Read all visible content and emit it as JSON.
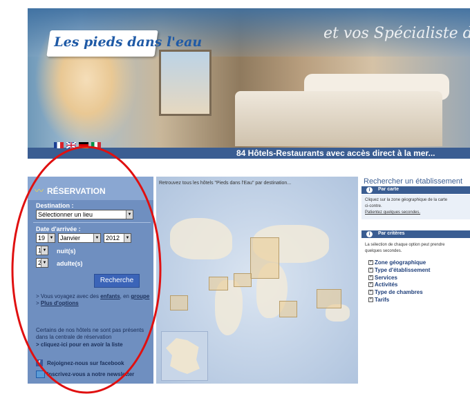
{
  "banner": {
    "logo": "Les pieds dans l'eau",
    "tagline": "et vos Spécialiste des Hôtels.",
    "bar_text": "84 Hôtels-Restaurants avec accès direct à la mer...",
    "flags": [
      "fr-flag-icon",
      "uk-flag-icon",
      "de-flag-icon",
      "it-flag-icon"
    ]
  },
  "reservation": {
    "title": "RÉSERVATION",
    "destination_label": "Destination :",
    "destination_value": "Sélectionner un lieu",
    "date_label": "Date d'arrivée :",
    "day": "19",
    "month": "Janvier",
    "year": "2012",
    "nights_value": "1",
    "nights_label": "nuit(s)",
    "adults_value": "2",
    "adults_label": "adulte(s)",
    "search_button": "Recherche",
    "travel_prefix": "> Vous voyagez avec des",
    "travel_children": "enfants",
    "travel_sep": ", en",
    "travel_group": "groupe",
    "more_options": "Plus d'options",
    "more_options_prefix": "> ",
    "notice_line1": "Certains de nos hôtels ne sont pas présents",
    "notice_line2": "dans la centrale de réservation",
    "notice_link": "> cliquez-ici pour en avoir la liste",
    "facebook": "Rejoignez-nous sur facebook",
    "newsletter": "Inscrivez-vous a notre newsletter"
  },
  "map": {
    "intro": "Retrouvez tous les hôtels \"Pieds dans l'Eau\" par destination..."
  },
  "search_panel": {
    "title": "Rechercher un établissement",
    "by_map": {
      "label": "Par carte",
      "line1": "Cliquez sur la zone géographique de la carte",
      "line2": "ci-contre.",
      "line3": "Patientez quelques secondes."
    },
    "by_criteria": {
      "label": "Par critères",
      "line1": "La sélection de chaque option peut prendre",
      "line2": "quelques secondes.",
      "items": [
        "Zone géographique",
        "Type d'établissement",
        "Services",
        "Activités",
        "Type de chambres",
        "Tarifs"
      ]
    }
  },
  "colors": {
    "sidebar": "#6f8fc0",
    "brand_blue": "#3a5d92",
    "oval": "#e01010"
  }
}
